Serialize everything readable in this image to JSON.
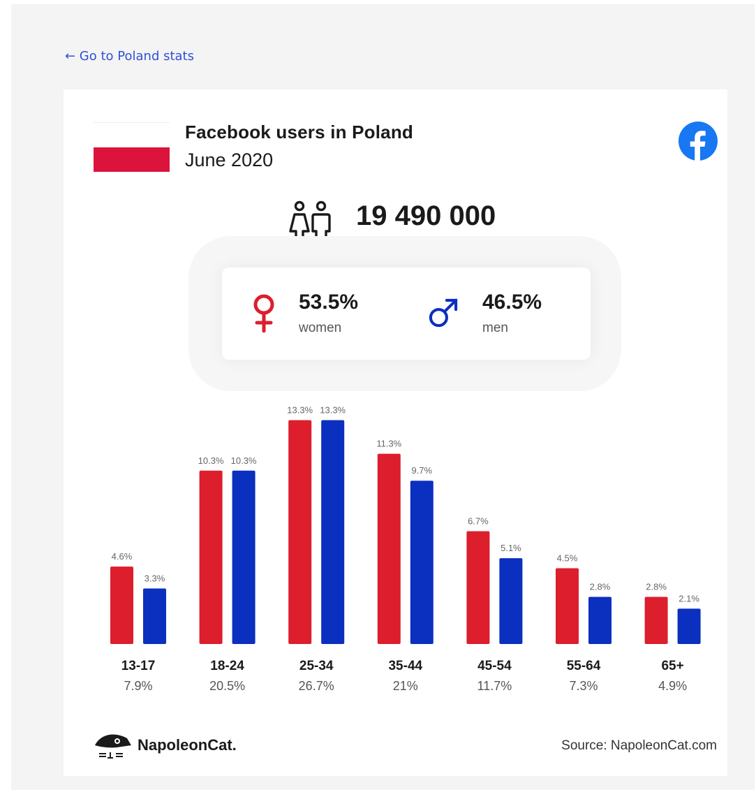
{
  "nav": {
    "back_label": "← Go to Poland stats"
  },
  "header": {
    "title": "Facebook users in Poland",
    "subtitle": "June 2020",
    "logo_icon": "facebook-icon",
    "flag_colors": [
      "#ffffff",
      "#dc143c"
    ]
  },
  "summary": {
    "users_icon": "users-icon",
    "total": "19 490 000",
    "women": {
      "icon": "female-icon",
      "percent": "53.5%",
      "label": "women",
      "color": "#dc1e2d"
    },
    "men": {
      "icon": "male-icon",
      "percent": "46.5%",
      "label": "men",
      "color": "#0b2fbf"
    }
  },
  "chart_data": {
    "type": "bar",
    "categories": [
      "13-17",
      "18-24",
      "25-34",
      "35-44",
      "45-54",
      "55-64",
      "65+"
    ],
    "category_totals": [
      "7.9%",
      "20.5%",
      "26.7%",
      "21%",
      "11.7%",
      "7.3%",
      "4.9%"
    ],
    "series": [
      {
        "values": [
          4.6,
          10.3,
          13.3,
          11.3,
          6.7,
          4.5,
          2.8
        ],
        "labels": [
          "4.6%",
          "10.3%",
          "13.3%",
          "11.3%",
          "6.7%",
          "4.5%",
          "2.8%"
        ],
        "color": "#dc1e2d"
      },
      {
        "values": [
          3.3,
          10.3,
          13.3,
          9.7,
          5.1,
          2.8,
          2.1
        ],
        "labels": [
          "3.3%",
          "10.3%",
          "13.3%",
          "9.7%",
          "5.1%",
          "2.8%",
          "2.1%"
        ],
        "color": "#0b2fbf"
      }
    ],
    "grid": false
  },
  "footer": {
    "brand_icon": "napoleoncat-icon",
    "brand_name": "NapoleonCat.",
    "source": "Source: NapoleonCat.com"
  }
}
